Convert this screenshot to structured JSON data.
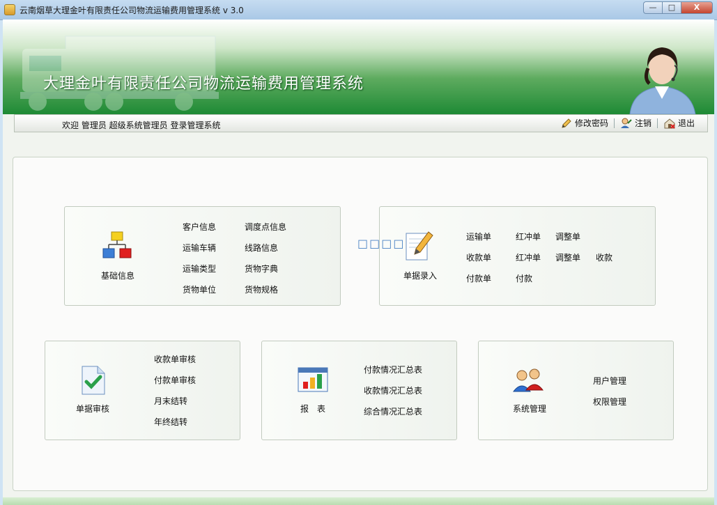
{
  "window": {
    "title": "云南烟草大理金叶有限责任公司物流运输费用管理系统 v 3.0",
    "buttons": {
      "minimize": "—",
      "maximize": "□",
      "close": "X"
    }
  },
  "banner": {
    "title": "大理金叶有限责任公司物流运输费用管理系统"
  },
  "navbar": {
    "welcome": "欢迎 管理员 超级系统管理员 登录管理系统",
    "change_password": "修改密码",
    "logout": "注销",
    "exit": "退出"
  },
  "modules": {
    "basic_info": {
      "label": "基础信息",
      "links": [
        "客户信息",
        "调度点信息",
        "运输车辆",
        "线路信息",
        "运输类型",
        "货物字典",
        "货物单位",
        "货物规格"
      ]
    },
    "document_entry": {
      "label": "单据录入",
      "links": [
        "运输单",
        "红冲单",
        "调整单",
        "收款单",
        "红冲单",
        "调整单",
        "收款",
        "付款单",
        "付款"
      ]
    },
    "document_audit": {
      "label": "单据审核",
      "links": [
        "收款单审核",
        "付款单审核",
        "月末结转",
        "年终结转"
      ]
    },
    "reports": {
      "label": "报　表",
      "links": [
        "付款情况汇总表",
        "收款情况汇总表",
        "综合情况汇总表"
      ]
    },
    "system_admin": {
      "label": "系统管理",
      "links": [
        "用户管理",
        "权限管理"
      ]
    }
  },
  "placeholder_glyphs": "□□□□"
}
